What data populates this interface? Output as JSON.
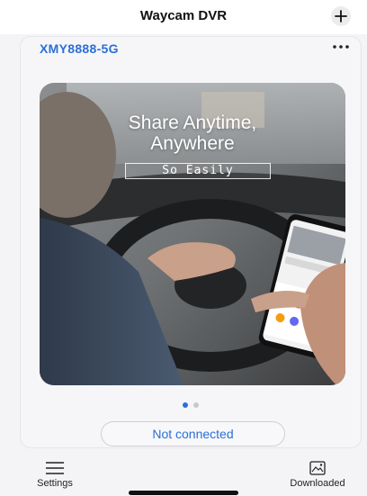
{
  "header": {
    "title": "Waycam DVR",
    "add_icon": "plus-icon"
  },
  "device": {
    "name": "XMY8888-5G",
    "more_icon": "more-dots-icon"
  },
  "banner": {
    "headline_line1": "Share Anytime,",
    "headline_line2": "Anywhere",
    "tagline": "So Easily",
    "pages_total": 2,
    "active_page": 1
  },
  "status": {
    "label": "Not connected"
  },
  "tabs": [
    {
      "label": "Settings",
      "icon": "menu-lines-icon"
    },
    {
      "label": "Downloaded",
      "icon": "gallery-icon"
    }
  ],
  "colors": {
    "accent": "#2b6fd6",
    "dot_active": "#2b6fd6",
    "dot_inactive": "#c8c8cc"
  }
}
